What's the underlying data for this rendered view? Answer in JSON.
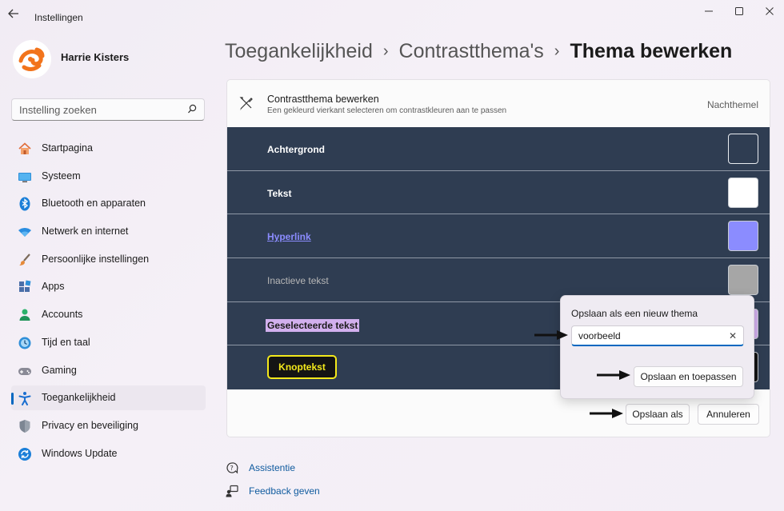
{
  "window": {
    "title": "Instellingen",
    "controls": [
      "minimize",
      "maximize",
      "close"
    ]
  },
  "user": {
    "name": "Harrie Kisters"
  },
  "search": {
    "placeholder": "Instelling zoeken"
  },
  "sidebar": {
    "items": [
      {
        "label": "Startpagina",
        "icon": "home-icon"
      },
      {
        "label": "Systeem",
        "icon": "monitor-icon"
      },
      {
        "label": "Bluetooth en apparaten",
        "icon": "bluetooth-icon"
      },
      {
        "label": "Netwerk en internet",
        "icon": "wifi-icon"
      },
      {
        "label": "Persoonlijke instellingen",
        "icon": "paintbrush-icon"
      },
      {
        "label": "Apps",
        "icon": "apps-icon"
      },
      {
        "label": "Accounts",
        "icon": "person-icon"
      },
      {
        "label": "Tijd en taal",
        "icon": "globe-clock-icon"
      },
      {
        "label": "Gaming",
        "icon": "gamepad-icon"
      },
      {
        "label": "Toegankelijkheid",
        "icon": "accessibility-icon",
        "active": true
      },
      {
        "label": "Privacy en beveiliging",
        "icon": "shield-icon"
      },
      {
        "label": "Windows Update",
        "icon": "update-icon"
      }
    ]
  },
  "breadcrumb": {
    "level1": "Toegankelijkheid",
    "level2": "Contrastthema's",
    "current": "Thema bewerken",
    "separator": "›"
  },
  "panel": {
    "title": "Contrastthema bewerken",
    "subtitle": "Een gekleurd vierkant selecteren om contrastkleuren aan te passen",
    "theme_name": "Nachthemel",
    "rows": [
      {
        "label": "Achtergrond",
        "swatch": "#2f3d52"
      },
      {
        "label": "Tekst",
        "swatch": "#ffffff"
      },
      {
        "label": "Hyperlink",
        "swatch": "#8b8cff"
      },
      {
        "label": "Inactieve tekst",
        "swatch": "#a6a6a6"
      },
      {
        "label": "Geselecteerde tekst",
        "swatch": "#d2b0ee"
      },
      {
        "label": "Knoptekst",
        "swatch": "#141414"
      }
    ],
    "save_as_label": "Opslaan als",
    "cancel_label": "Annuleren"
  },
  "popup": {
    "title": "Opslaan als een nieuw thema",
    "input_value": "voorbeeld",
    "apply_label": "Opslaan en toepassen"
  },
  "links": {
    "help": "Assistentie",
    "feedback": "Feedback geven"
  },
  "colors": {
    "accent": "#0067c0",
    "row_bg": "#2f3d52",
    "link": "#0e5a9e"
  }
}
